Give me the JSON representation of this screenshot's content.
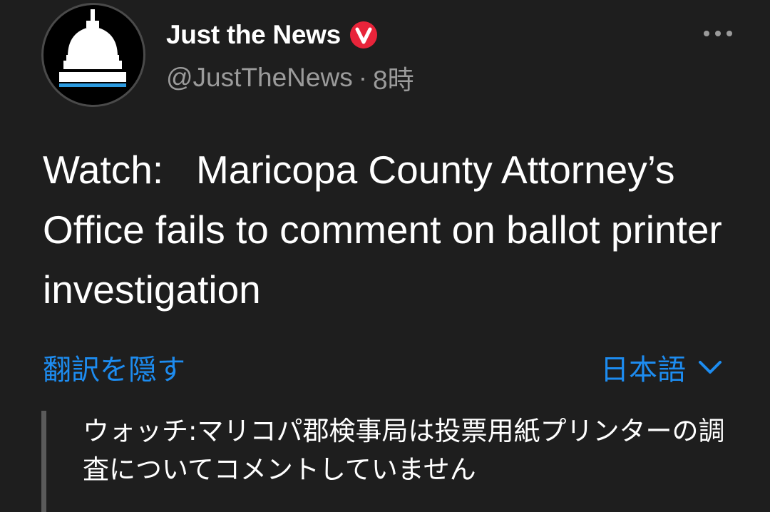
{
  "author": {
    "display_name": "Just the News",
    "handle": "@JustTheNews",
    "separator": "·",
    "time": "8時",
    "avatar_icon": "capitol-dome-icon",
    "verified_icon": "verified-badge-icon",
    "verified_letter": "V",
    "badge_color": "#e8243a"
  },
  "menu": {
    "more_icon": "more-options-icon"
  },
  "tweet": {
    "text": "Watch:   Maricopa County Attorney’s Office fails to comment on ballot printer investigation"
  },
  "translation": {
    "hide_label": "翻訳を隠す",
    "language_label": "日本語",
    "language_icon": "chevron-down-icon",
    "text": "ウォッチ:マリコパ郡検事局は投票用紙プリンターの調査についてコメントしていません"
  },
  "colors": {
    "background": "#1e1e1e",
    "link": "#1d8cf0",
    "muted": "#9b9b9b",
    "avatar_stripe": "#2d9be0"
  }
}
